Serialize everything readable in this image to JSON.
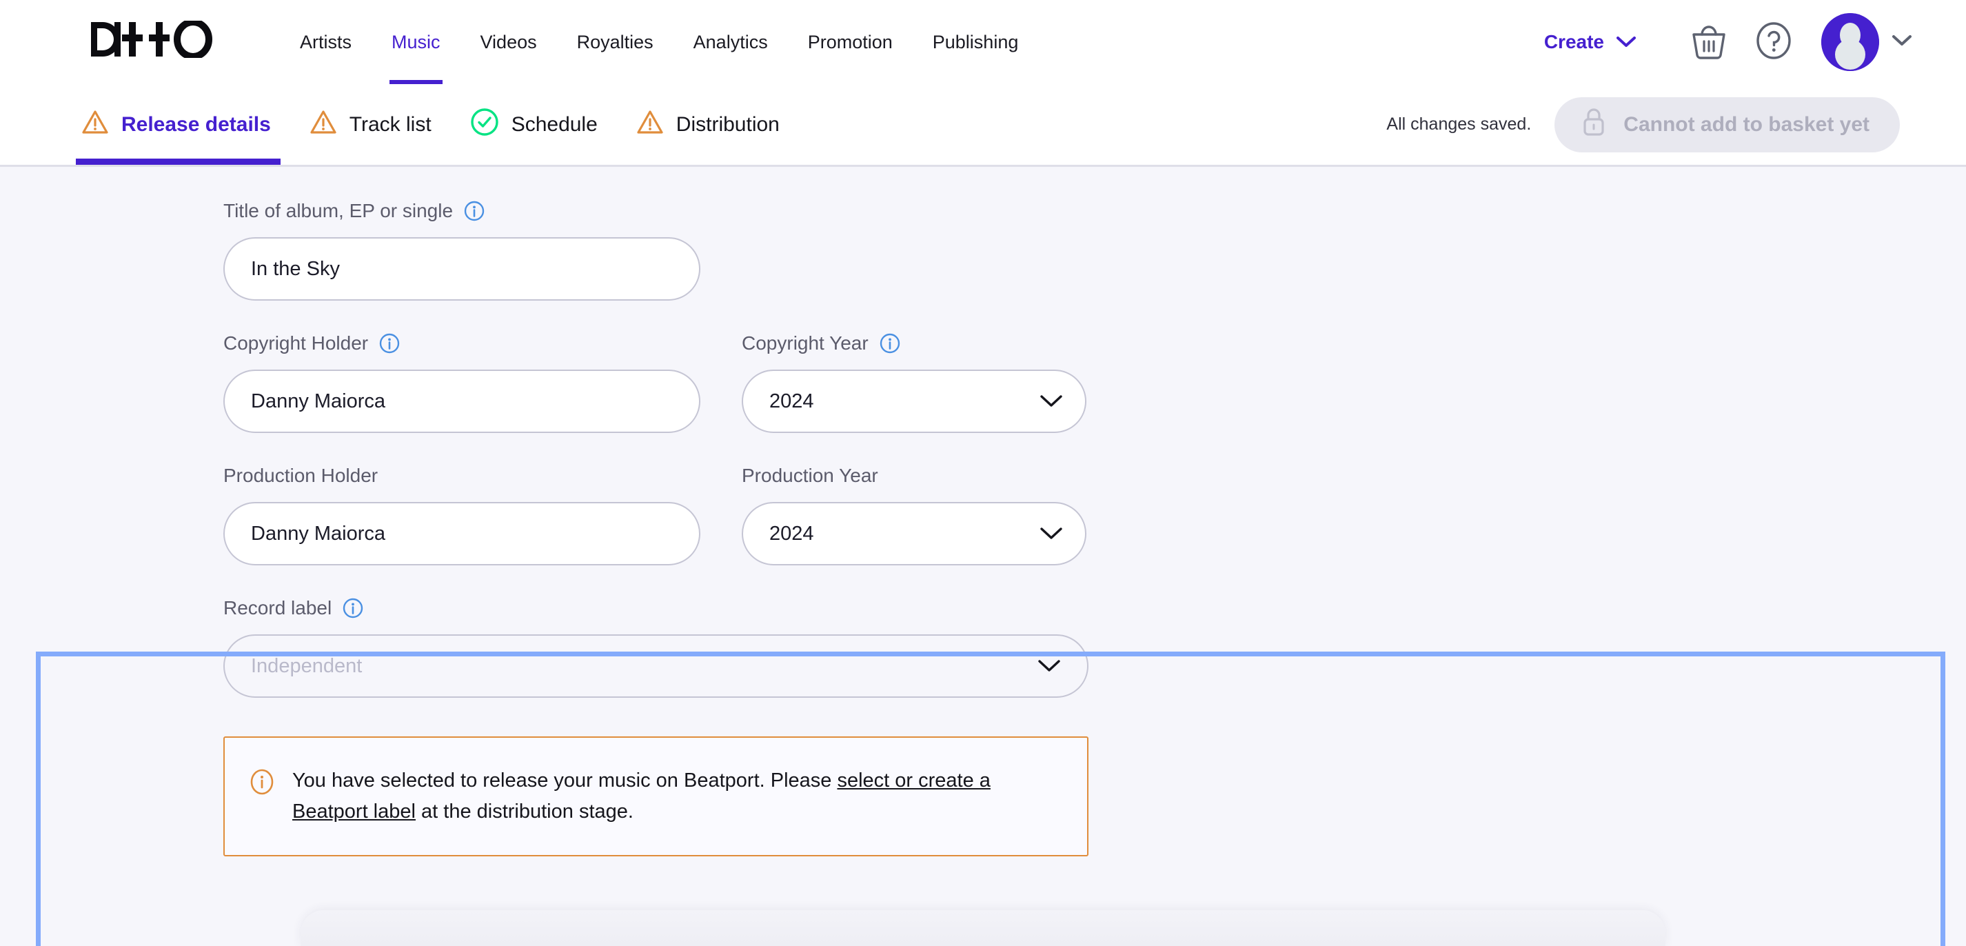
{
  "brand": {
    "logo_text": "DI++O",
    "accent_color": "#4520cf",
    "info_icon_color": "#4a90e2",
    "warning_color": "#e08d3c",
    "success_color": "#06e383",
    "highlight_border_color": "#84abfb"
  },
  "topnav": {
    "items": [
      {
        "label": "Artists",
        "active": false
      },
      {
        "label": "Music",
        "active": true
      },
      {
        "label": "Videos",
        "active": false
      },
      {
        "label": "Royalties",
        "active": false
      },
      {
        "label": "Analytics",
        "active": false
      },
      {
        "label": "Promotion",
        "active": false
      },
      {
        "label": "Publishing",
        "active": false
      }
    ],
    "create_label": "Create",
    "icons": {
      "create_chevron": "chevron-down-icon",
      "basket": "basket-icon",
      "help": "help-circle-icon",
      "avatar": "avatar-icon",
      "avatar_chevron": "chevron-down-icon"
    }
  },
  "steptabs": {
    "items": [
      {
        "label": "Release details",
        "status": "warning",
        "active": true
      },
      {
        "label": "Track list",
        "status": "warning",
        "active": false
      },
      {
        "label": "Schedule",
        "status": "complete",
        "active": false
      },
      {
        "label": "Distribution",
        "status": "warning",
        "active": false
      }
    ],
    "saved_status": "All changes saved.",
    "basket_button_label": "Cannot add to basket yet",
    "basket_button_icon": "lock-icon",
    "basket_button_disabled": true
  },
  "form": {
    "title": {
      "label": "Title of album, EP or single",
      "has_info": true,
      "value": "In the Sky",
      "placeholder": ""
    },
    "copyright_holder": {
      "label": "Copyright Holder",
      "has_info": true,
      "value": "Danny Maiorca",
      "placeholder": ""
    },
    "copyright_year": {
      "label": "Copyright Year",
      "has_info": true,
      "value": "2024"
    },
    "production_holder": {
      "label": "Production Holder",
      "has_info": false,
      "value": "Danny Maiorca",
      "placeholder": ""
    },
    "production_year": {
      "label": "Production Year",
      "has_info": false,
      "value": "2024"
    },
    "record_label": {
      "label": "Record label",
      "has_info": true,
      "value": "",
      "placeholder": "Independent"
    }
  },
  "alert": {
    "icon": "info-circle-icon",
    "text_before_link": "You have selected to release your music on Beatport. Please ",
    "link_text": "select or create a Beatport label",
    "text_after_link": " at the distribution stage."
  }
}
